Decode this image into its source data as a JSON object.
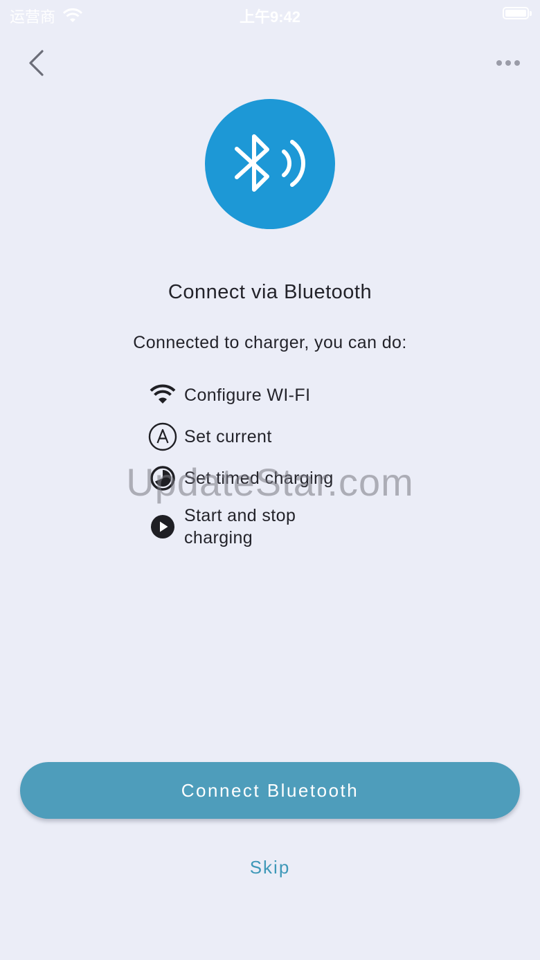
{
  "status_bar": {
    "carrier": "运营商",
    "time": "上午9:42",
    "wifi_icon": "wifi-icon",
    "battery_icon": "battery-icon"
  },
  "nav": {
    "back_icon": "chevron-left-icon",
    "more_icon": "ellipsis-icon"
  },
  "hero": {
    "icon": "bluetooth-icon",
    "color": "#1d98d6"
  },
  "content": {
    "title": "Connect via Bluetooth",
    "subtitle": "Connected to charger, you can do:",
    "features": [
      {
        "icon": "wifi-icon",
        "label": "Configure WI-FI"
      },
      {
        "icon": "ampere-icon",
        "label": "Set current"
      },
      {
        "icon": "timer-icon",
        "label": "Set timed charging"
      },
      {
        "icon": "play-icon",
        "label": "Start and stop charging"
      }
    ]
  },
  "watermark": "UpdateStar.com",
  "actions": {
    "connect_label": "Connect Bluetooth",
    "skip_label": "Skip",
    "accent": "#4e9dbb"
  }
}
